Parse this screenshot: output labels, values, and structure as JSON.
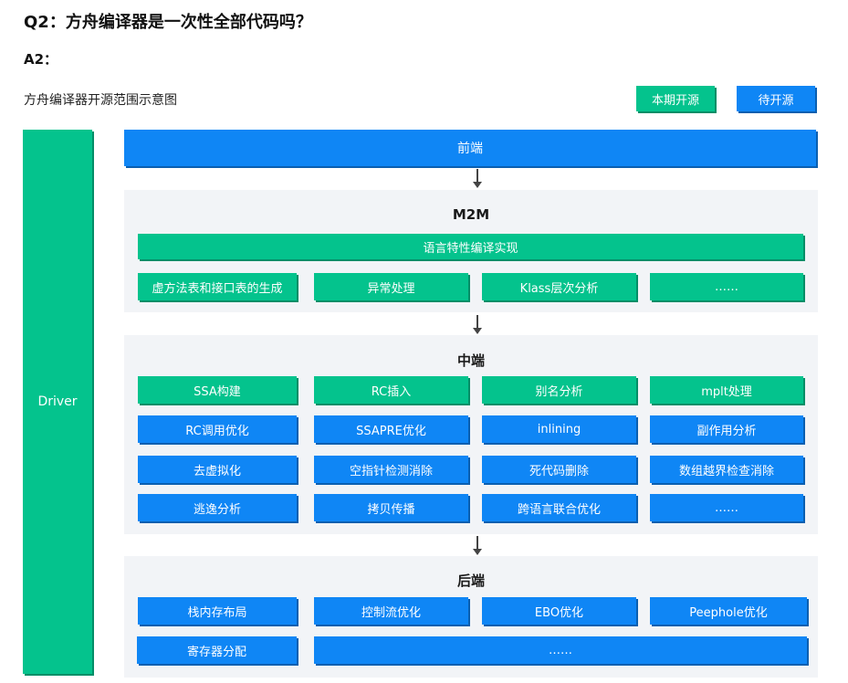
{
  "question": "Q2：方舟编译器是一次性全部代码吗？",
  "answer_label": "A2：",
  "diagram_caption": "方舟编译器开源范围示意图",
  "legend": {
    "current": "本期开源",
    "pending": "待开源"
  },
  "colors": {
    "open_now": "#04c38d",
    "to_open": "#0f86f5",
    "panel": "#f2f4f7"
  },
  "driver": "Driver",
  "frontend": "前端",
  "m2m": {
    "title": "M2M",
    "top": "语言特性编译实现",
    "items": [
      "虚方法表和接口表的生成",
      "异常处理",
      "Klass层次分析",
      "……"
    ]
  },
  "midend": {
    "title": "中端",
    "rows": [
      [
        "SSA构建",
        "RC插入",
        "别名分析",
        "mplt处理"
      ],
      [
        "RC调用优化",
        "SSAPRE优化",
        "inlining",
        "副作用分析"
      ],
      [
        "去虚拟化",
        "空指针检测消除",
        "死代码删除",
        "数组越界检查消除"
      ],
      [
        "逃逸分析",
        "拷贝传播",
        "跨语言联合优化",
        "……"
      ]
    ]
  },
  "backend": {
    "title": "后端",
    "row1": [
      "栈内存布局",
      "控制流优化",
      "EBO优化",
      "Peephole优化"
    ],
    "row2": [
      "寄存器分配",
      "……"
    ]
  }
}
